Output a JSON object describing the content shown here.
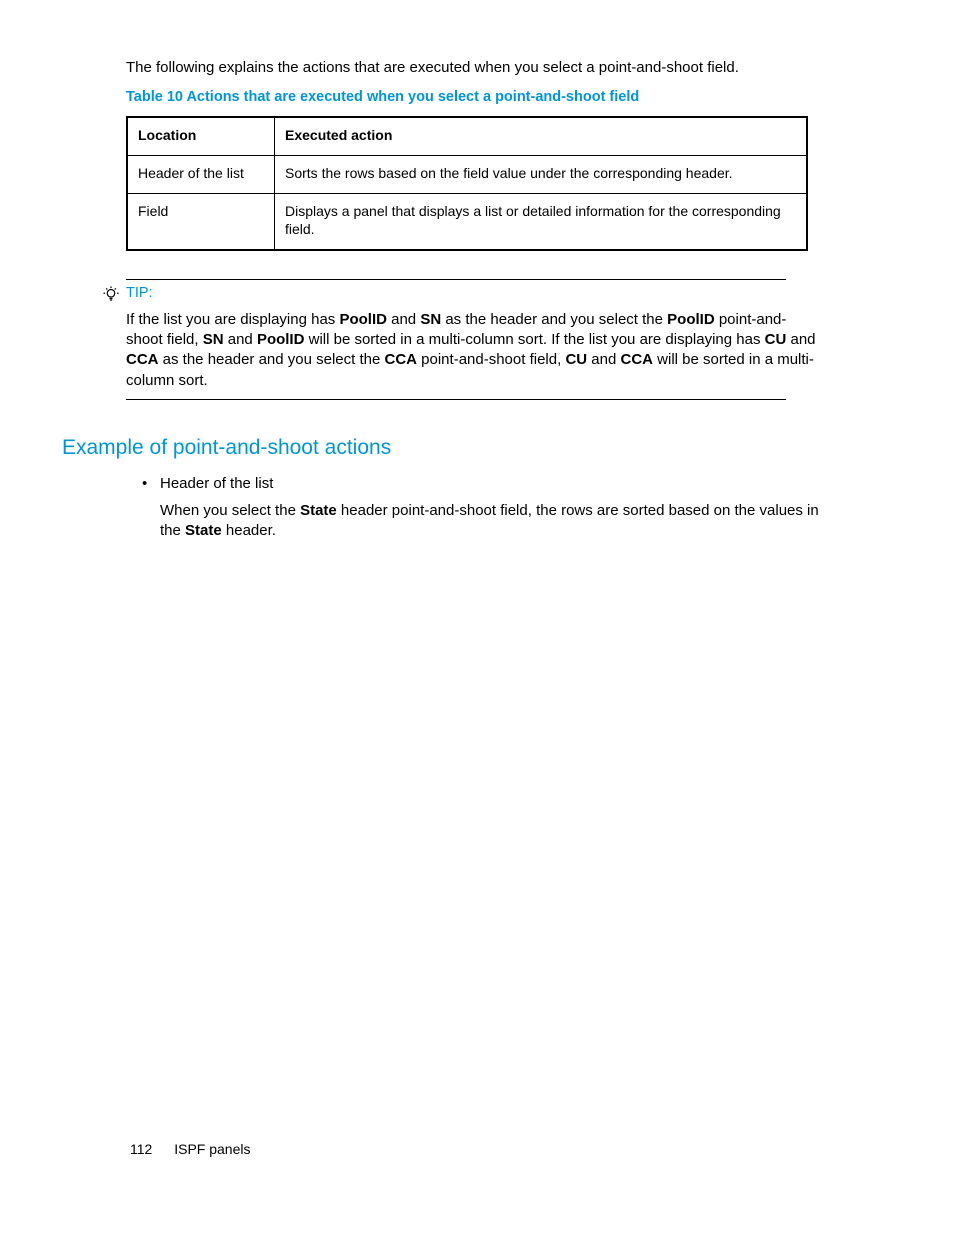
{
  "intro": "The following explains the actions that are executed when you select a point-and-shoot field.",
  "table": {
    "caption": "Table 10 Actions that are executed when you select a point-and-shoot field",
    "headers": {
      "col1": "Location",
      "col2": "Executed action"
    },
    "rows": [
      {
        "c1": "Header of the list",
        "c2": "Sorts the rows based on the field value under the corresponding header."
      },
      {
        "c1": "Field",
        "c2": "Displays a panel that displays a list or detailed information for the corresponding field."
      }
    ]
  },
  "tip": {
    "label": "TIP:",
    "parts": {
      "p0": "If the list you are displaying has ",
      "b0": "PoolID",
      "p1": " and ",
      "b1": "SN",
      "p2": " as the header and you select the ",
      "b2": "PoolID",
      "p3": " point-and-shoot field, ",
      "b3": "SN",
      "p4": " and ",
      "b4": "PoolID",
      "p5": " will be sorted in a multi-column sort. If the list you are displaying has ",
      "b5": "CU",
      "p6": " and ",
      "b6": "CCA",
      "p7": " as the header and you select the ",
      "b7": "CCA",
      "p8": " point-and-shoot field, ",
      "b8": "CU",
      "p9": " and ",
      "b9": "CCA",
      "p10": " will be sorted in a multi-column sort."
    }
  },
  "section_heading": "Example of point-and-shoot actions",
  "bullet1": "Header of the list",
  "sub": {
    "p0": "When you select the ",
    "b0": "State",
    "p1": " header point-and-shoot field, the rows are sorted based on the values in the ",
    "b1": "State",
    "p2": " header."
  },
  "footer": {
    "page": "112",
    "title": "ISPF panels"
  }
}
